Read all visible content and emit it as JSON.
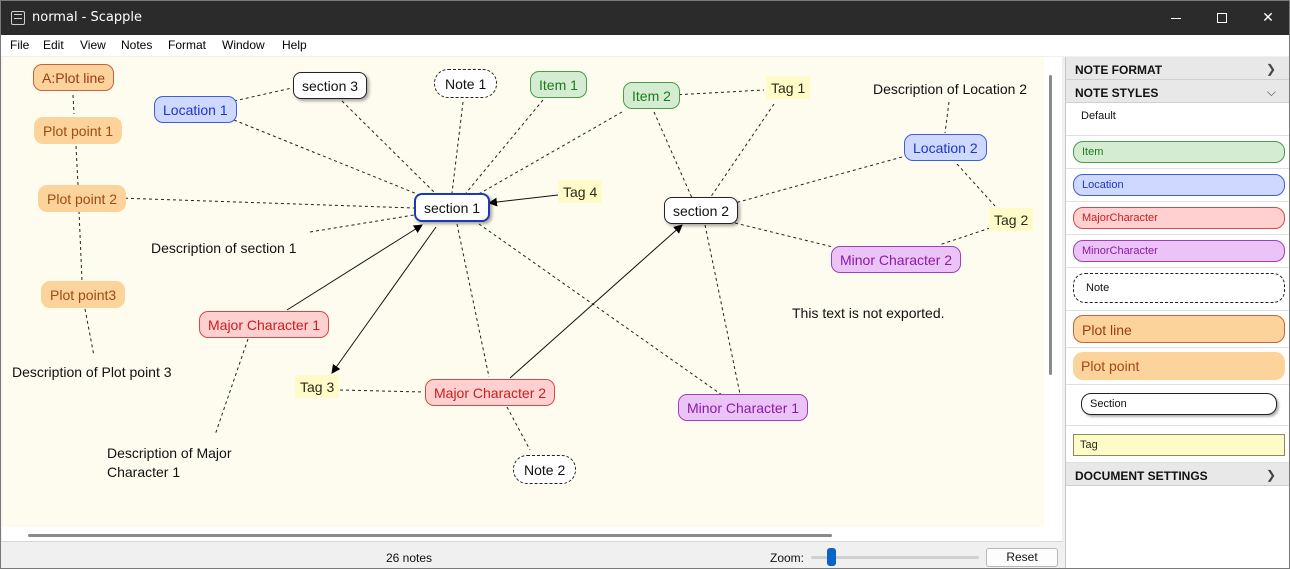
{
  "window": {
    "title": "normal - Scapple"
  },
  "menu": [
    "File",
    "Edit",
    "View",
    "Notes",
    "Format",
    "Window",
    "Help"
  ],
  "canvas": {
    "notes": {
      "a_plot_line": "A:Plot line",
      "plot_point_1": "Plot point 1",
      "plot_point_2": "Plot point 2",
      "plot_point_3": "Plot point3",
      "desc_plot_point_3": "Description of Plot point 3",
      "location_1": "Location 1",
      "section_3": "section 3",
      "note_1": "Note 1",
      "item_1": "Item 1",
      "item_2": "Item 2",
      "tag_1": "Tag 1",
      "desc_location_2": "Description of Location 2",
      "location_2": "Location 2",
      "section_1": "section 1",
      "tag_4": "Tag 4",
      "section_2": "section 2",
      "tag_2": "Tag 2",
      "desc_section_1": "Description of section 1",
      "minor_character_2": "Minor Character 2",
      "major_character_1": "Major Character 1",
      "not_exported": "This text is not exported.",
      "tag_3": "Tag 3",
      "major_character_2": "Major Character 2",
      "minor_character_1": "Minor Character 1",
      "desc_major_character_1_line1": "Description of Major",
      "desc_major_character_1_line2": "Character 1",
      "note_2": "Note 2"
    }
  },
  "status": {
    "note_count": "26 notes",
    "zoom_label": "Zoom:",
    "zoom_level": 0.1,
    "reset_label": "Reset"
  },
  "sidebar": {
    "note_format_header": "NOTE FORMAT",
    "note_styles_header": "NOTE STYLES",
    "document_settings_header": "DOCUMENT SETTINGS",
    "styles": {
      "default": "Default",
      "item": "Item",
      "location": "Location",
      "major": "MajorCharacter",
      "minor": "MinorCharacter",
      "note": "Note",
      "plot_line": "Plot line",
      "plot_point": "Plot point",
      "section": "Section",
      "tag": "Tag"
    }
  }
}
